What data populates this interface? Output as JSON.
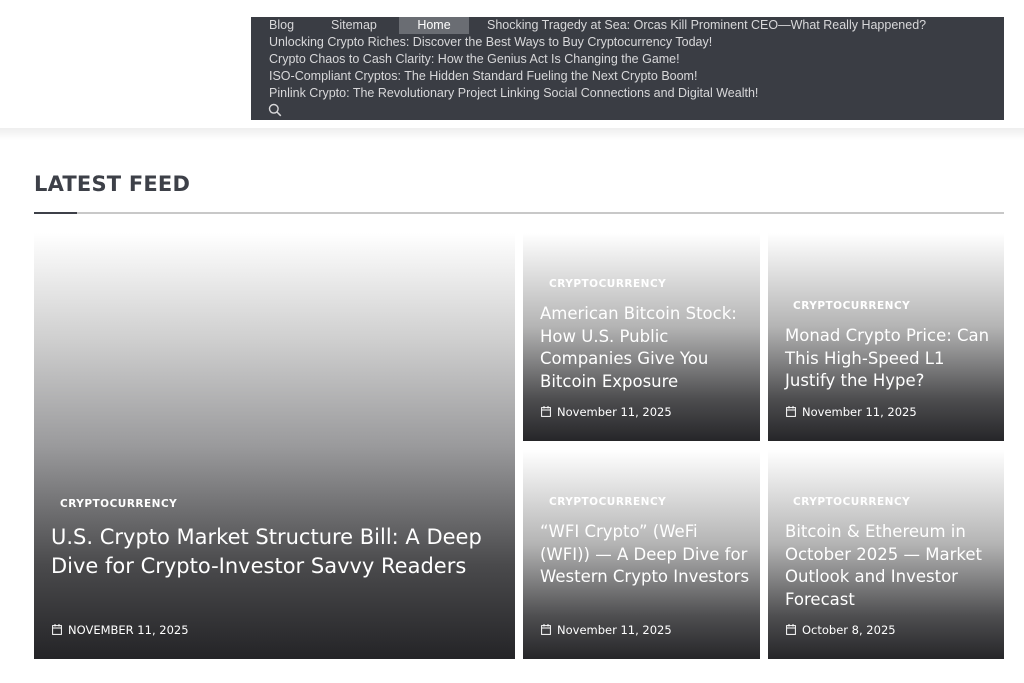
{
  "nav": {
    "blog": "Blog",
    "sitemap": "Sitemap",
    "home": "Home",
    "links": [
      "Shocking Tragedy at Sea: Orcas Kill Prominent CEO—What Really Happened?",
      "Unlocking Crypto Riches: Discover the Best Ways to Buy Cryptocurrency Today!",
      "Crypto Chaos to Cash Clarity: How the Genius Act Is Changing the Game!",
      "ISO-Compliant Cryptos: The Hidden Standard Fueling the Next Crypto Boom!",
      "Pinlink Crypto: The Revolutionary Project Linking Social Connections and Digital Wealth!"
    ],
    "search_icon": "search-icon"
  },
  "section": {
    "title": "LATEST FEED"
  },
  "featured": {
    "category": "CRYPTOCURRENCY",
    "title": "U.S. Crypto Market Structure Bill: A Deep Dive for Crypto-Investor Savvy Readers",
    "date": "NOVEMBER 11, 2025"
  },
  "cards": [
    {
      "category": "CRYPTOCURRENCY",
      "title": "American Bitcoin Stock: How U.S. Public Companies Give You Bitcoin Exposure",
      "date": "November 11, 2025"
    },
    {
      "category": "CRYPTOCURRENCY",
      "title": "Monad Crypto Price: Can This High-Speed L1 Justify the Hype?",
      "date": "November 11, 2025"
    },
    {
      "category": "CRYPTOCURRENCY",
      "title": "“WFI Crypto” (WeFi (WFI)) — A Deep Dive for Western Crypto Investors",
      "date": "November 11, 2025"
    },
    {
      "category": "CRYPTOCURRENCY",
      "title": "Bitcoin & Ethereum in October 2025 — Market Outlook and Investor Forecast",
      "date": "October 8, 2025"
    }
  ],
  "colors": {
    "nav_bg": "#3a3d44",
    "home_bg": "#6a6d73",
    "title_text": "#3d4048"
  }
}
